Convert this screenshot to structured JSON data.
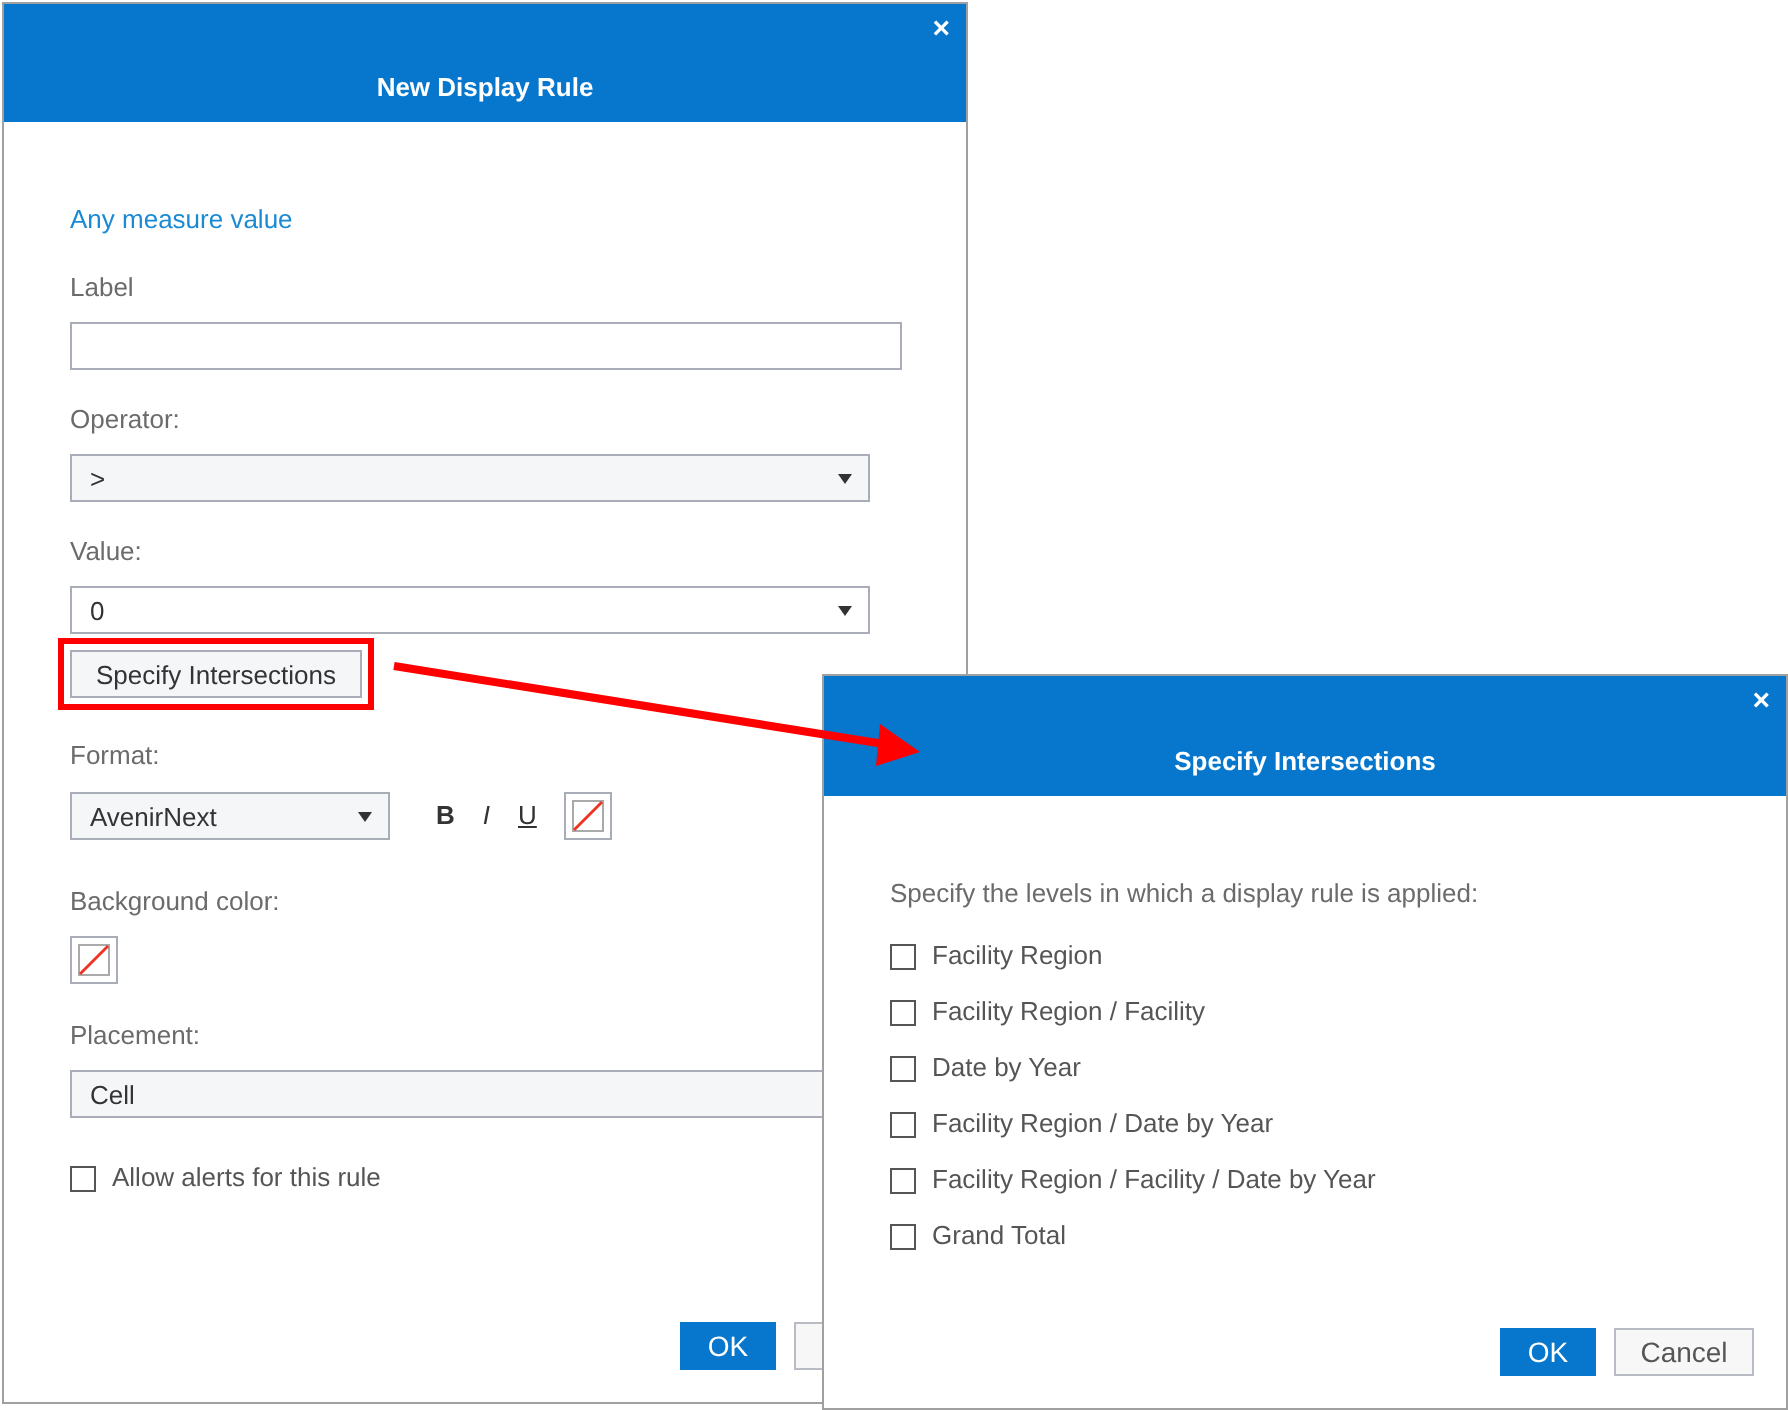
{
  "display_rule_dialog": {
    "title": "New Display Rule",
    "close": "×",
    "measure_link": "Any measure value",
    "label_field": {
      "label": "Label"
    },
    "operator": {
      "label": "Operator:",
      "value": ">"
    },
    "value": {
      "label": "Value:",
      "value": "0"
    },
    "intersections_button": "Specify Intersections",
    "format": {
      "label": "Format:",
      "font": "AvenirNext",
      "bold": "B",
      "italic": "I",
      "underline": "U"
    },
    "background_color": {
      "label": "Background color:"
    },
    "placement": {
      "label": "Placement:",
      "value": "Cell"
    },
    "alerts": {
      "label": "Allow alerts for this rule",
      "checked": false
    },
    "ok_button": "OK"
  },
  "intersections_dialog": {
    "title": "Specify Intersections",
    "close": "×",
    "prompt": "Specify the levels in which a display rule is applied:",
    "levels": [
      {
        "label": "Facility Region",
        "checked": false
      },
      {
        "label": "Facility Region / Facility",
        "checked": false
      },
      {
        "label": "Date by Year",
        "checked": false
      },
      {
        "label": "Facility Region / Date by Year",
        "checked": false
      },
      {
        "label": "Facility Region / Facility / Date by Year",
        "checked": false
      },
      {
        "label": "Grand Total",
        "checked": false
      }
    ],
    "ok_button": "OK",
    "cancel_button": "Cancel"
  }
}
